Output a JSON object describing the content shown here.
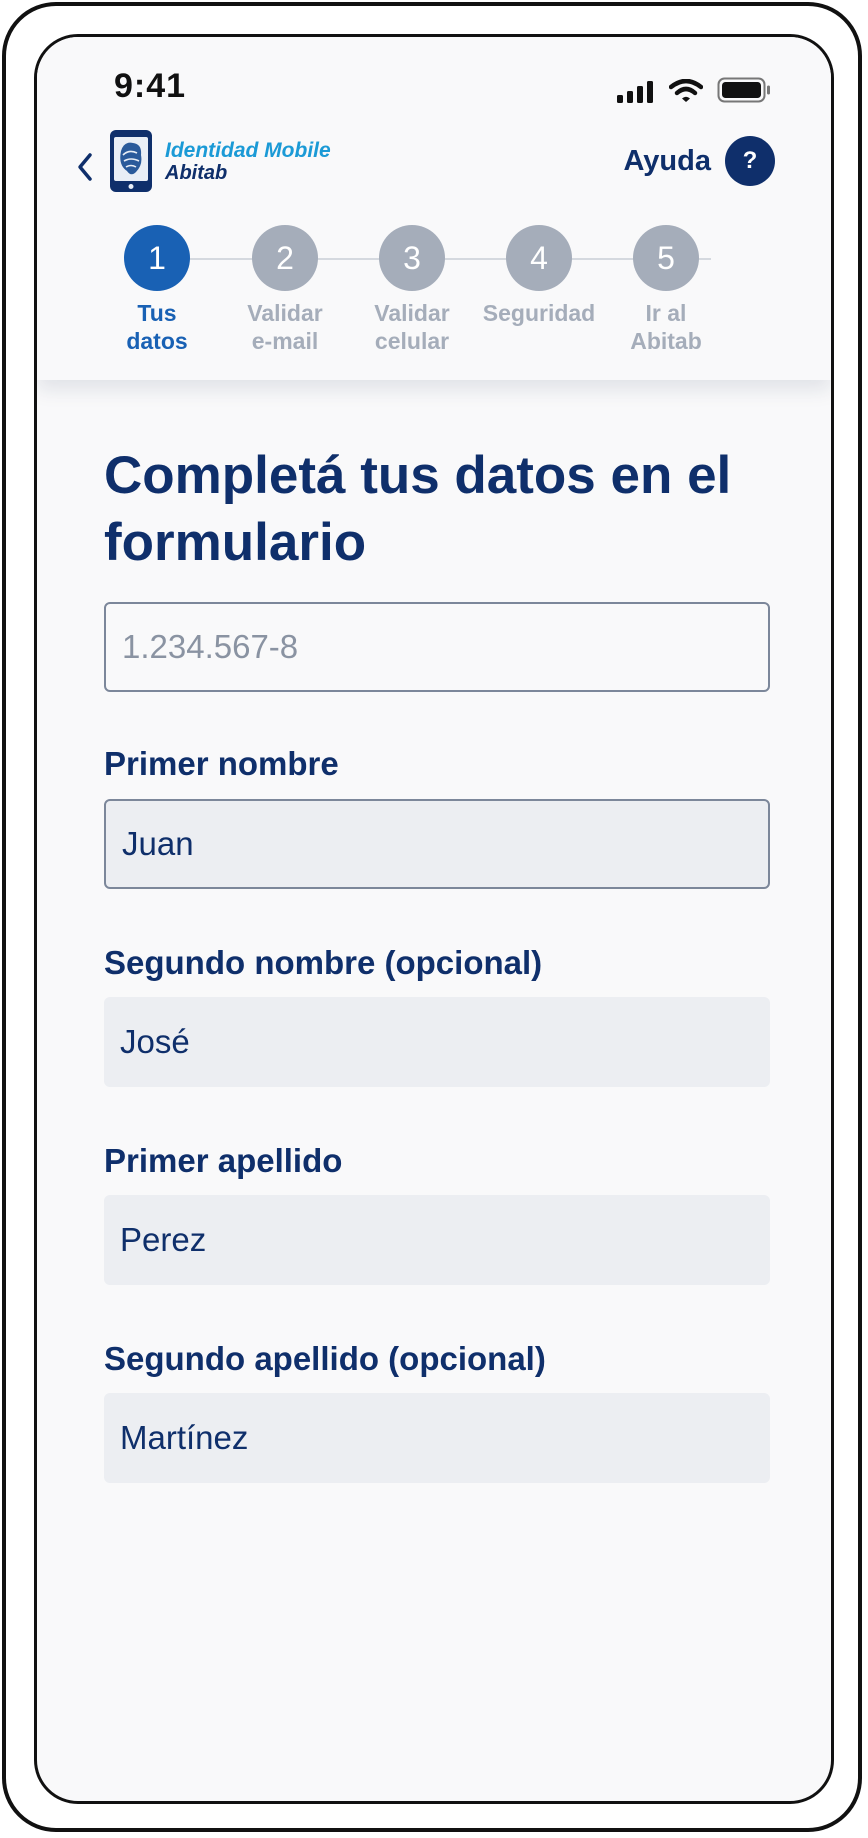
{
  "status_bar": {
    "time": "9:41",
    "icons": [
      "signal-icon",
      "wifi-icon",
      "battery-icon"
    ]
  },
  "header": {
    "back_icon": "chevron-left-icon",
    "logo": {
      "line1": "Identidad Mobile",
      "line2": "Abitab"
    },
    "help": {
      "label": "Ayuda",
      "icon_glyph": "?"
    }
  },
  "stepper": {
    "active_step": 1,
    "steps": [
      {
        "number": "1",
        "label_line1": "Tus",
        "label_line2": "datos"
      },
      {
        "number": "2",
        "label_line1": "Validar",
        "label_line2": "e-mail"
      },
      {
        "number": "3",
        "label_line1": "Validar",
        "label_line2": "celular"
      },
      {
        "number": "4",
        "label_line1": "Seguridad",
        "label_line2": ""
      },
      {
        "number": "5",
        "label_line1": "Ir al",
        "label_line2": "Abitab"
      }
    ]
  },
  "form": {
    "title": "Completá tus datos en el formulario",
    "document": {
      "placeholder": "1.234.567-8",
      "value": ""
    },
    "first_name": {
      "label": "Primer nombre",
      "value": "Juan"
    },
    "second_name": {
      "label": "Segundo nombre (opcional)",
      "value": "José"
    },
    "first_surname": {
      "label": "Primer apellido",
      "value": "Perez"
    },
    "second_surname": {
      "label": "Segundo apellido (opcional)",
      "value": "Martínez"
    }
  },
  "colors": {
    "primary": "#0f2f6b",
    "accent": "#1961b4",
    "logo_blue": "#1b9ad6",
    "inactive_step": "#a5adba",
    "input_fill": "#eceef2"
  }
}
